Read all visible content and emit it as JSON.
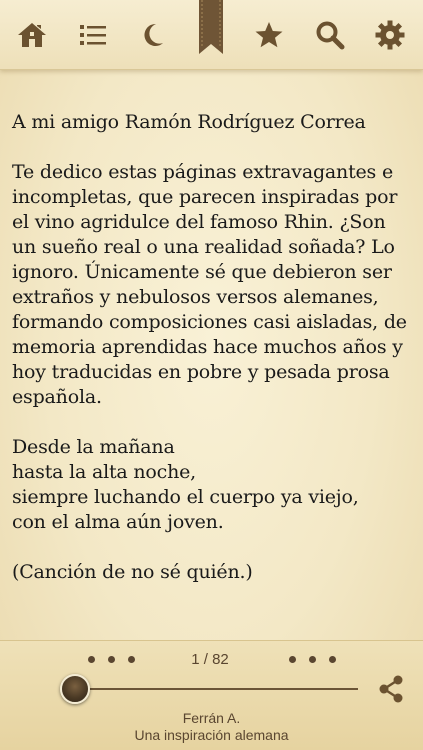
{
  "toolbar": {
    "icons": [
      "home-icon",
      "list-icon",
      "moon-icon",
      "bookmark-ribbon-icon",
      "star-icon",
      "search-icon",
      "gear-icon"
    ],
    "icon_color": "#6b5230"
  },
  "content": {
    "dedication": "A mi amigo Ramón Rodríguez Correa",
    "paragraph": "Te dedico estas páginas extravagantes e incompletas, que parecen inspiradas por el vino agridulce del famoso Rhin. ¿Son un sueño real o una realidad soñada? Lo ignoro. Únicamente sé que debieron ser extraños y nebulosos versos alemanes, formando composiciones casi aisladas, de memoria aprendidas hace muchos años y hoy traducidas en pobre y pesada prosa española.",
    "verse": [
      "Desde la mañana",
      "hasta la alta noche,",
      "siempre luchando el cuerpo ya viejo,",
      "con el alma aún joven."
    ],
    "attribution": "(Canción de no sé quién.)"
  },
  "footer": {
    "page_indicator": "1 / 82",
    "progress_fraction": 0.01,
    "author": "Ferrán A.",
    "book_title": "Una inspiración alemana"
  }
}
